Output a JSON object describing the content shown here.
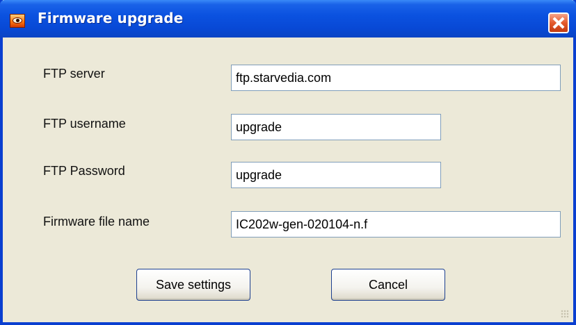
{
  "window": {
    "title": "Firmware upgrade",
    "icon": "eye-icon",
    "close_icon": "close-icon"
  },
  "form": {
    "ftp_server": {
      "label": "FTP server",
      "value": "ftp.starvedia.com"
    },
    "ftp_username": {
      "label": "FTP username",
      "value": "upgrade"
    },
    "ftp_password": {
      "label": "FTP Password",
      "value": "upgrade"
    },
    "firmware_file": {
      "label": "Firmware file name",
      "value": "IC202w-gen-020104-n.f"
    }
  },
  "buttons": {
    "save_label": "Save settings",
    "cancel_label": "Cancel"
  },
  "colors": {
    "titlebar": "#0b52e0",
    "close_button": "#e45a2c",
    "background": "#ece9d8"
  }
}
